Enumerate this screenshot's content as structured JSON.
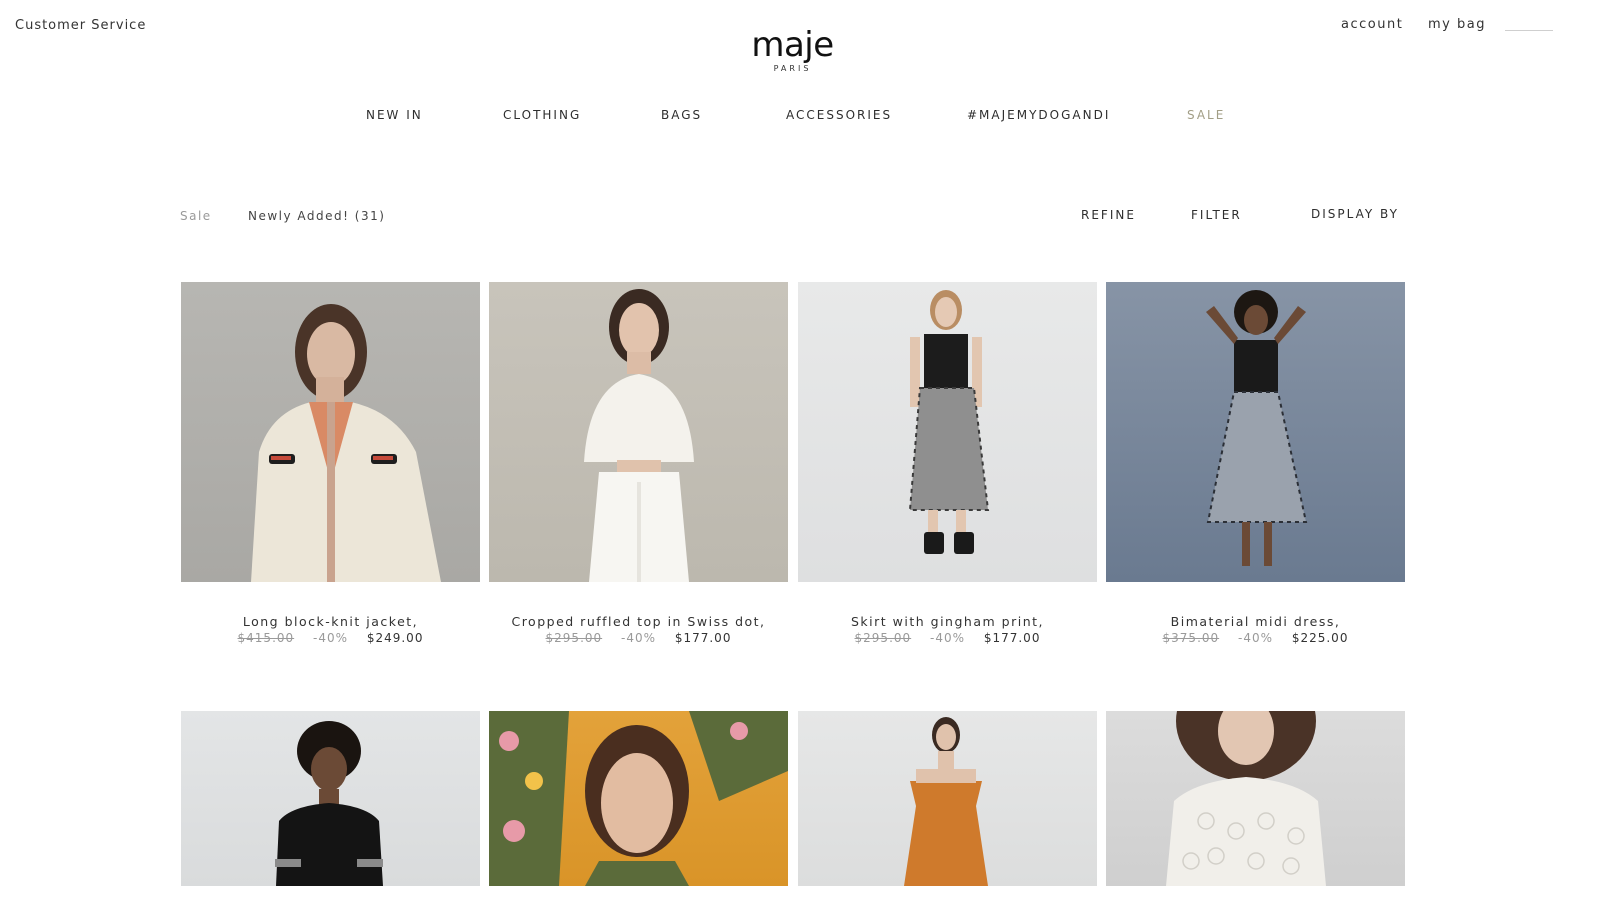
{
  "header": {
    "customer_service": "Customer Service",
    "logo": "maje",
    "logo_sub": "PARIS",
    "account": "account",
    "bag": "my bag"
  },
  "nav": {
    "items": [
      "NEW IN",
      "CLOTHING",
      "BAGS",
      "ACCESSORIES",
      "#MAJEMYDOGANDI",
      "SALE"
    ]
  },
  "toolbar": {
    "breadcrumb_root": "Sale",
    "breadcrumb_current": "Newly Added! (31)",
    "refine": "REFINE",
    "filter": "FILTER",
    "display_by": "DISPLAY BY"
  },
  "products": [
    {
      "name": "Long block-knit jacket,",
      "old_price": "$415.00",
      "discount": "-40%",
      "price": "$249.00"
    },
    {
      "name": "Cropped ruffled top in Swiss dot,",
      "old_price": "$295.00",
      "discount": "-40%",
      "price": "$177.00"
    },
    {
      "name": "Skirt with gingham print,",
      "old_price": "$295.00",
      "discount": "-40%",
      "price": "$177.00"
    },
    {
      "name": "Bimaterial midi dress,",
      "old_price": "$375.00",
      "discount": "-40%",
      "price": "$225.00"
    }
  ],
  "colors": {
    "sale_accent": "#a29e86",
    "muted_text": "#9a9a9a",
    "text": "#2e2e2e"
  }
}
